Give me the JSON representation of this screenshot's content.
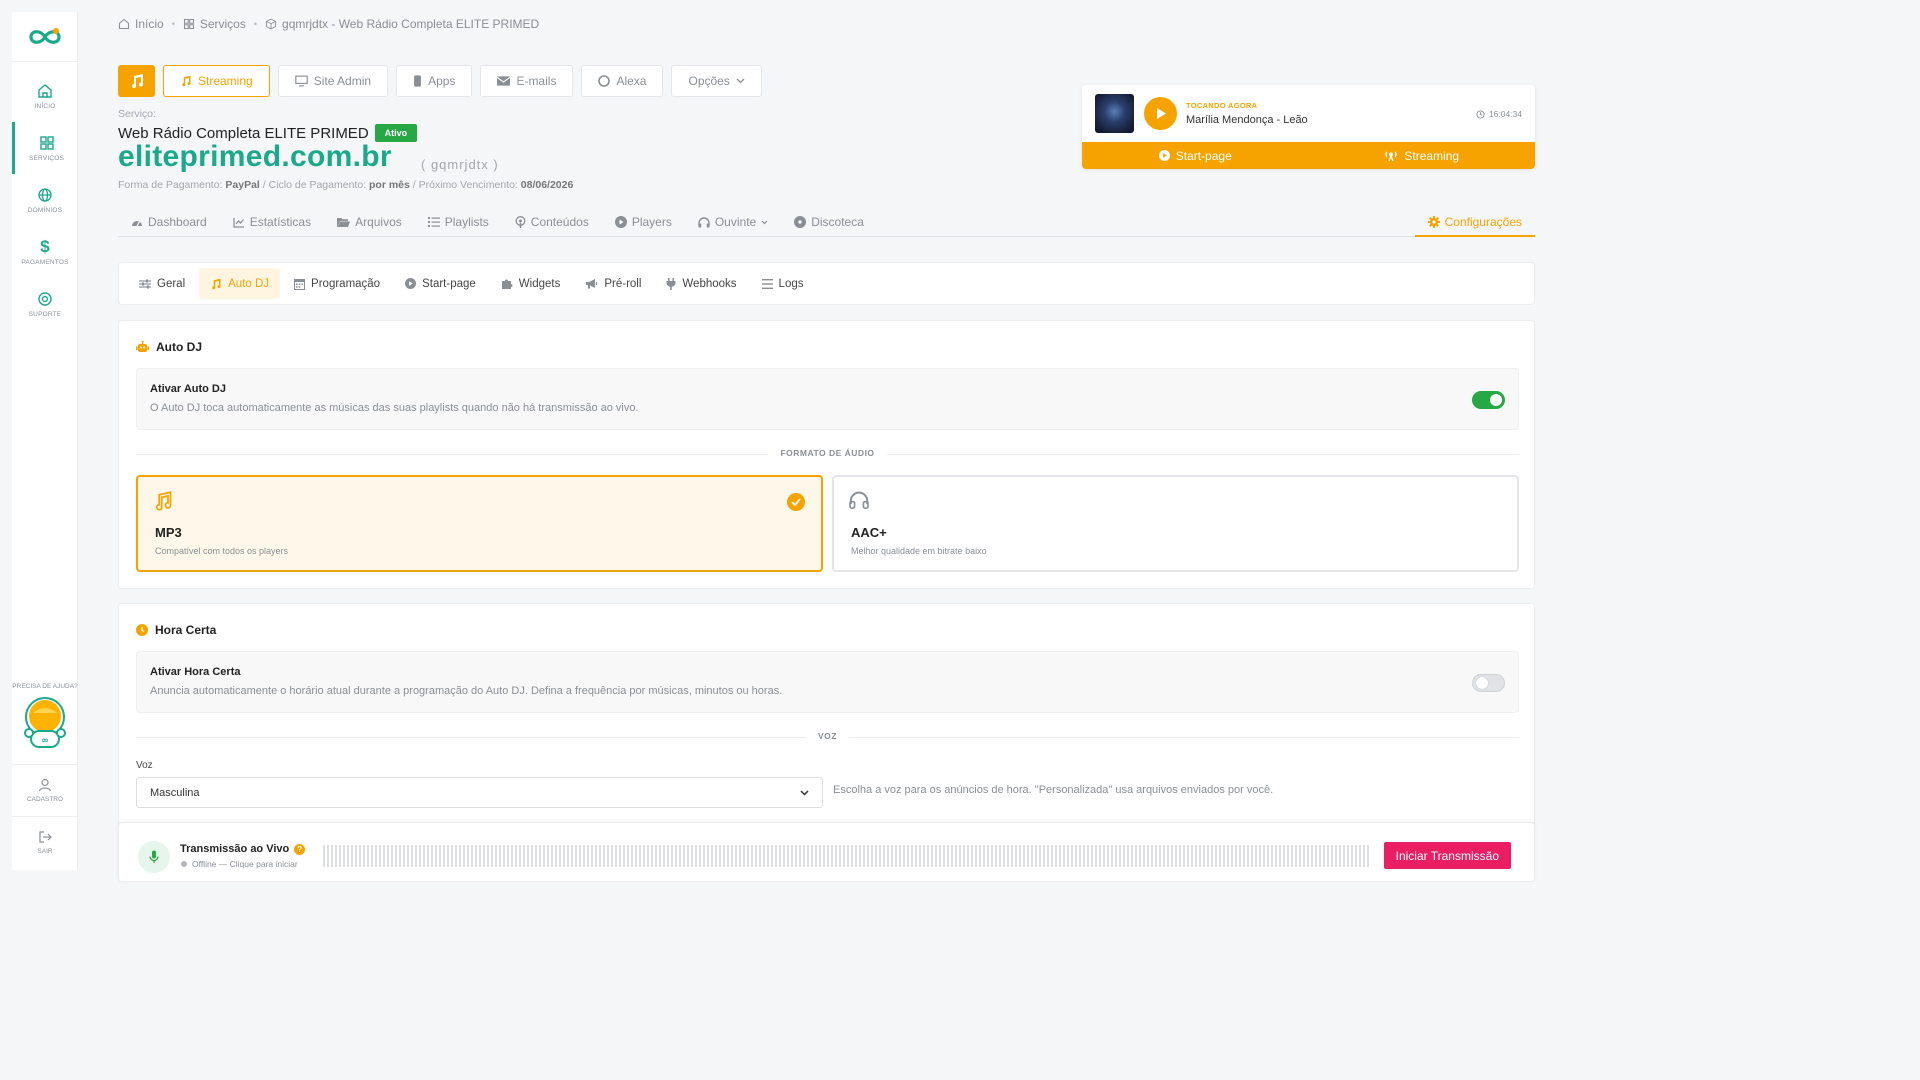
{
  "colors": {
    "accent": "#f6a300",
    "brand": "#1aa98b",
    "success": "#28a745",
    "danger": "#e91e63"
  },
  "sidebar": {
    "items": [
      {
        "label": "Início",
        "icon": "home-icon"
      },
      {
        "label": "Serviços",
        "icon": "grid-icon",
        "active": true
      },
      {
        "label": "Domínios",
        "icon": "globe-icon"
      },
      {
        "label": "Pagamentos",
        "icon": "dollar-icon"
      },
      {
        "label": "Suporte",
        "icon": "lifebuoy-icon"
      }
    ],
    "help": "PRECISA DE AJUDA?",
    "account_label": "Cadastro",
    "logout_label": "Sair"
  },
  "breadcrumb": {
    "home": "Início",
    "services": "Serviços",
    "current": "gqmrjdtx - Web Rádio Completa ELITE PRIMED"
  },
  "top_tabs": {
    "streaming": "Streaming",
    "site_admin": "Site Admin",
    "apps": "Apps",
    "emails": "E-mails",
    "alexa": "Alexa",
    "options": "Opções"
  },
  "service": {
    "label": "Serviço:",
    "name": "Web Rádio Completa ELITE PRIMED",
    "status": "Ativo",
    "domain": "eliteprimed.com.br",
    "username": "( gqmrjdtx )",
    "payment_label": "Forma de Pagamento:",
    "payment_method": "PayPal",
    "cycle_label": "/ Ciclo de Pagamento:",
    "cycle": "por mês",
    "due_label": "/ Próximo Vencimento:",
    "due": "08/06/2026"
  },
  "now_playing": {
    "label": "TOCANDO AGORA",
    "song": "Marília Mendonça - Leão",
    "time": "16:04:34",
    "startpage": "Start-page",
    "streaming": "Streaming"
  },
  "main_nav": {
    "dashboard": "Dashboard",
    "stats": "Estatísticas",
    "files": "Arquivos",
    "playlists": "Playlists",
    "contents": "Conteúdos",
    "players": "Players",
    "listener": "Ouvinte",
    "discoteca": "Discoteca",
    "settings": "Configurações"
  },
  "sub_tabs": {
    "geral": "Geral",
    "autodj": "Auto DJ",
    "programacao": "Programação",
    "startpage": "Start-page",
    "widgets": "Widgets",
    "preroll": "Pré-roll",
    "webhooks": "Webhooks",
    "logs": "Logs"
  },
  "autodj": {
    "title": "Auto DJ",
    "enable_title": "Ativar Auto DJ",
    "enable_desc": "O Auto DJ toca automaticamente as músicas das suas playlists quando não há transmissão ao vivo.",
    "enabled": true,
    "format_label": "FORMATO DE ÁUDIO",
    "mp3_title": "MP3",
    "mp3_desc": "Compatível com todos os players",
    "aac_title": "AAC+",
    "aac_desc": "Melhor qualidade em bitrate baixo",
    "selected_format": "MP3"
  },
  "hora_certa": {
    "title": "Hora Certa",
    "enable_title": "Ativar Hora Certa",
    "enable_desc": "Anuncia automaticamente o horário atual durante a programação do Auto DJ. Defina a frequência por músicas, minutos ou horas.",
    "enabled": false,
    "voice_section": "VOZ",
    "voice_label": "Voz",
    "voice_value": "Masculina",
    "voice_help": "Escolha a voz para os anúncios de hora. \"Personalizada\" usa arquivos enviados por você."
  },
  "live": {
    "title": "Transmissão ao Vivo",
    "help": "?",
    "status": "Offline — Clique para iniciar",
    "button": "Iniciar Transmissão"
  }
}
